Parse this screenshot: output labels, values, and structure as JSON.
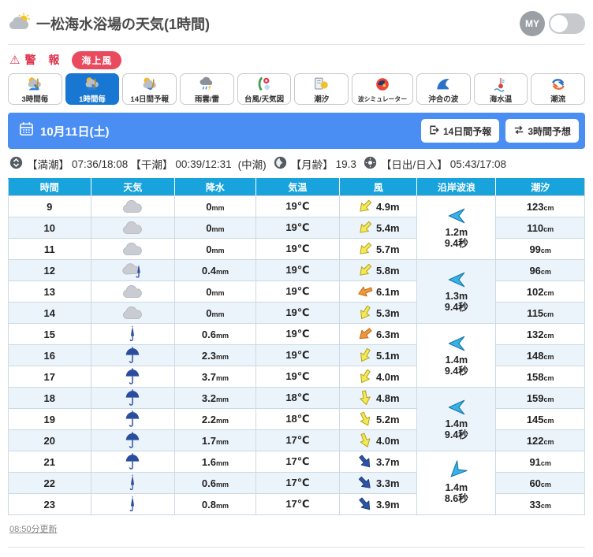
{
  "header": {
    "title": "一松海水浴場の天気(1時間)",
    "my_badge": "MY",
    "toggle_state": "off"
  },
  "alert": {
    "warning_label": "警 報",
    "warning_icon": "⚠",
    "badge_label": "海上風"
  },
  "tabs": {
    "items": [
      {
        "label": "3時間毎",
        "icon": "sun-cloud-wave",
        "active": false
      },
      {
        "label": "1時間毎",
        "icon": "sun-cloud-wave",
        "active": true
      },
      {
        "label": "14日間予報",
        "icon": "sun-cloud",
        "active": false
      },
      {
        "label": "雨雲/雷",
        "icon": "rain-cloud",
        "active": false
      },
      {
        "label": "台風/天気図",
        "icon": "typhoon-map",
        "active": false
      },
      {
        "label": "潮汐",
        "icon": "tide-calendar",
        "active": false
      },
      {
        "label": "波シミュレーター",
        "icon": "wave-simulator",
        "active": false
      },
      {
        "label": "沖合の波",
        "icon": "offshore-wave",
        "active": false
      },
      {
        "label": "海水温",
        "icon": "sea-thermometer",
        "active": false
      },
      {
        "label": "潮流",
        "icon": "sea-current",
        "active": false
      }
    ]
  },
  "date_bar": {
    "date": "10月11日(土)",
    "btn_14day": "14日間予報",
    "btn_3hour": "3時間予想"
  },
  "tide_info": {
    "high_label": "【満潮】",
    "high_times": "07:36/18:08",
    "low_label": "【干潮】",
    "low_times": "00:39/12:31",
    "phase": "(中潮)",
    "moon_label": "【月齢】",
    "moon_age": "19.3",
    "sun_label": "【日出/日入】",
    "sun_times": "05:43/17:08"
  },
  "table": {
    "headers": [
      "時間",
      "天気",
      "降水",
      "気温",
      "風",
      "沿岸波浪",
      "潮汐"
    ],
    "units": {
      "precip": "mm",
      "tide": "cm"
    },
    "wind_colors": {
      "yellow": {
        "fill": "#f3e952",
        "stroke": "#b3a024"
      },
      "orange": {
        "fill": "#f0973a",
        "stroke": "#bc6a12"
      },
      "blue": {
        "fill": "#2d55a5",
        "stroke": "#1c3a78"
      }
    },
    "wave_color": {
      "fill": "#38b2e6",
      "stroke": "#1878ad"
    },
    "rows": [
      {
        "hour": "9",
        "weather": "cloud",
        "precip": "0",
        "temp": "19℃",
        "wind_speed": "4.9m",
        "wind_dir": 135,
        "wind_color": "yellow",
        "tide": "123"
      },
      {
        "hour": "10",
        "weather": "cloud",
        "precip": "0",
        "temp": "19℃",
        "wind_speed": "5.4m",
        "wind_dir": 135,
        "wind_color": "yellow",
        "tide": "110"
      },
      {
        "hour": "11",
        "weather": "cloud",
        "precip": "0",
        "temp": "19℃",
        "wind_speed": "5.7m",
        "wind_dir": 135,
        "wind_color": "yellow",
        "tide": "99"
      },
      {
        "hour": "12",
        "weather": "cloud-umbrella",
        "precip": "0.4",
        "temp": "19℃",
        "wind_speed": "5.8m",
        "wind_dir": 135,
        "wind_color": "yellow",
        "tide": "96"
      },
      {
        "hour": "13",
        "weather": "cloud",
        "precip": "0",
        "temp": "19℃",
        "wind_speed": "6.1m",
        "wind_dir": 160,
        "wind_color": "orange",
        "tide": "102"
      },
      {
        "hour": "14",
        "weather": "cloud",
        "precip": "0",
        "temp": "19℃",
        "wind_speed": "5.3m",
        "wind_dir": 120,
        "wind_color": "yellow",
        "tide": "115"
      },
      {
        "hour": "15",
        "weather": "umbrella-closed",
        "precip": "0.6",
        "temp": "19℃",
        "wind_speed": "6.3m",
        "wind_dir": 140,
        "wind_color": "orange",
        "tide": "132"
      },
      {
        "hour": "16",
        "weather": "umbrella-open",
        "precip": "2.3",
        "temp": "19℃",
        "wind_speed": "5.1m",
        "wind_dir": 120,
        "wind_color": "yellow",
        "tide": "148"
      },
      {
        "hour": "17",
        "weather": "umbrella-open",
        "precip": "3.7",
        "temp": "19℃",
        "wind_speed": "4.0m",
        "wind_dir": 120,
        "wind_color": "yellow",
        "tide": "158"
      },
      {
        "hour": "18",
        "weather": "umbrella-open",
        "precip": "3.2",
        "temp": "18℃",
        "wind_speed": "4.8m",
        "wind_dir": 80,
        "wind_color": "yellow",
        "tide": "159"
      },
      {
        "hour": "19",
        "weather": "umbrella-open",
        "precip": "2.2",
        "temp": "18℃",
        "wind_speed": "5.2m",
        "wind_dir": 65,
        "wind_color": "yellow",
        "tide": "145"
      },
      {
        "hour": "20",
        "weather": "umbrella-open",
        "precip": "1.7",
        "temp": "17℃",
        "wind_speed": "4.0m",
        "wind_dir": 70,
        "wind_color": "yellow",
        "tide": "122"
      },
      {
        "hour": "21",
        "weather": "umbrella-open",
        "precip": "1.6",
        "temp": "17℃",
        "wind_speed": "3.7m",
        "wind_dir": 50,
        "wind_color": "blue",
        "tide": "91"
      },
      {
        "hour": "22",
        "weather": "umbrella-closed",
        "precip": "0.6",
        "temp": "17℃",
        "wind_speed": "3.3m",
        "wind_dir": 45,
        "wind_color": "blue",
        "tide": "60"
      },
      {
        "hour": "23",
        "weather": "umbrella-closed",
        "precip": "0.8",
        "temp": "17℃",
        "wind_speed": "3.9m",
        "wind_dir": 50,
        "wind_color": "blue",
        "tide": "33"
      }
    ],
    "wave_groups": [
      {
        "height": "1.2m",
        "period": "9.4秒",
        "rot": 0
      },
      {
        "height": "1.3m",
        "period": "9.4秒",
        "rot": 0
      },
      {
        "height": "1.4m",
        "period": "9.4秒",
        "rot": 0
      },
      {
        "height": "1.4m",
        "period": "9.4秒",
        "rot": 0
      },
      {
        "height": "1.4m",
        "period": "8.6秒",
        "rot": -45
      }
    ]
  },
  "footer": {
    "updated": "08:50分更新"
  },
  "colors": {
    "date_bar_blue": "#4a8ef4",
    "table_header_blue": "#18a3dc",
    "active_tab_blue": "#1877d2",
    "alert_red": "#e0304a",
    "badge_red": "#ea4a5e",
    "row_alt": "#ecf4fb"
  }
}
